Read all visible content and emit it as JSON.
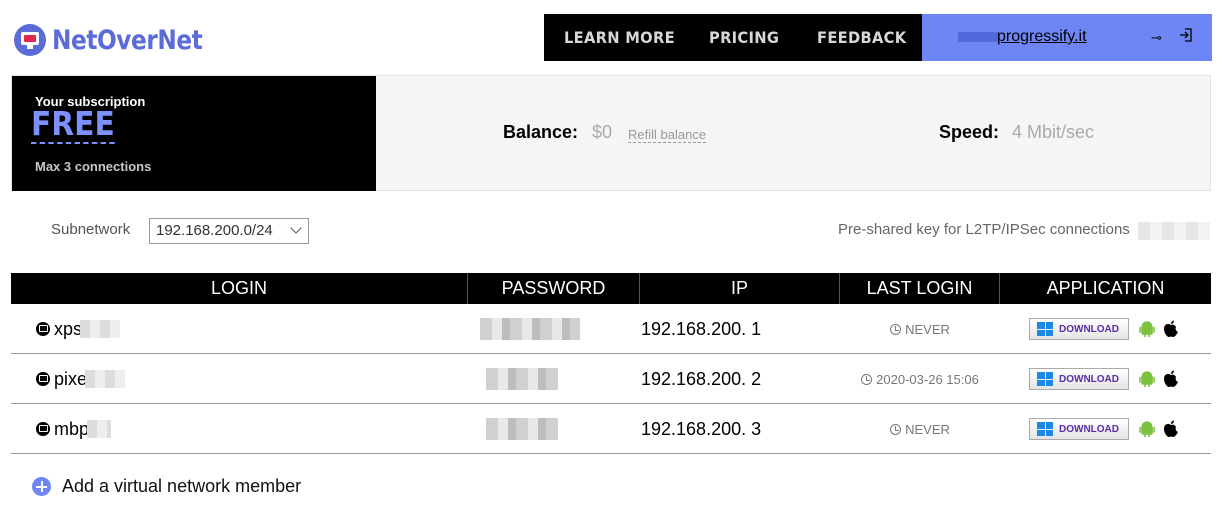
{
  "header": {
    "logo_text": "NetOverNet",
    "nav": [
      {
        "label": "LEARN MORE"
      },
      {
        "label": "PRICING"
      },
      {
        "label": "FEEDBACK"
      }
    ],
    "user_email": "progressify.it",
    "icons": {
      "key": "key-icon",
      "logout": "logout-icon"
    }
  },
  "subscription": {
    "label": "Your subscription",
    "plan": "FREE",
    "connections": "Max 3 connections",
    "balance_label": "Balance:",
    "balance_value": "$0",
    "refill_label": "Refill balance",
    "speed_label": "Speed:",
    "speed_value": "4 Mbit/sec"
  },
  "subnet": {
    "label": "Subnetwork",
    "value": "192.168.200.0/24",
    "psk_label": "Pre-shared key for L2TP/IPSec connections"
  },
  "table": {
    "headers": [
      "LOGIN",
      "PASSWORD",
      "IP",
      "LAST LOGIN",
      "APPLICATION"
    ],
    "rows": [
      {
        "login": "xps",
        "ip": "192.168.200. 1",
        "last_login": "NEVER",
        "download": "DOWNLOAD"
      },
      {
        "login": "pixe",
        "ip": "192.168.200. 2",
        "last_login": "2020-03-26 15:06",
        "download": "DOWNLOAD"
      },
      {
        "login": "mbp",
        "ip": "192.168.200. 3",
        "last_login": "NEVER",
        "download": "DOWNLOAD"
      }
    ]
  },
  "add_member": {
    "label": "Add a virtual network member"
  },
  "colors": {
    "brand": "#5b6bd8",
    "accent": "#6e86f5",
    "nav_bg": "#000000",
    "plan_text": "#7c90ff"
  }
}
